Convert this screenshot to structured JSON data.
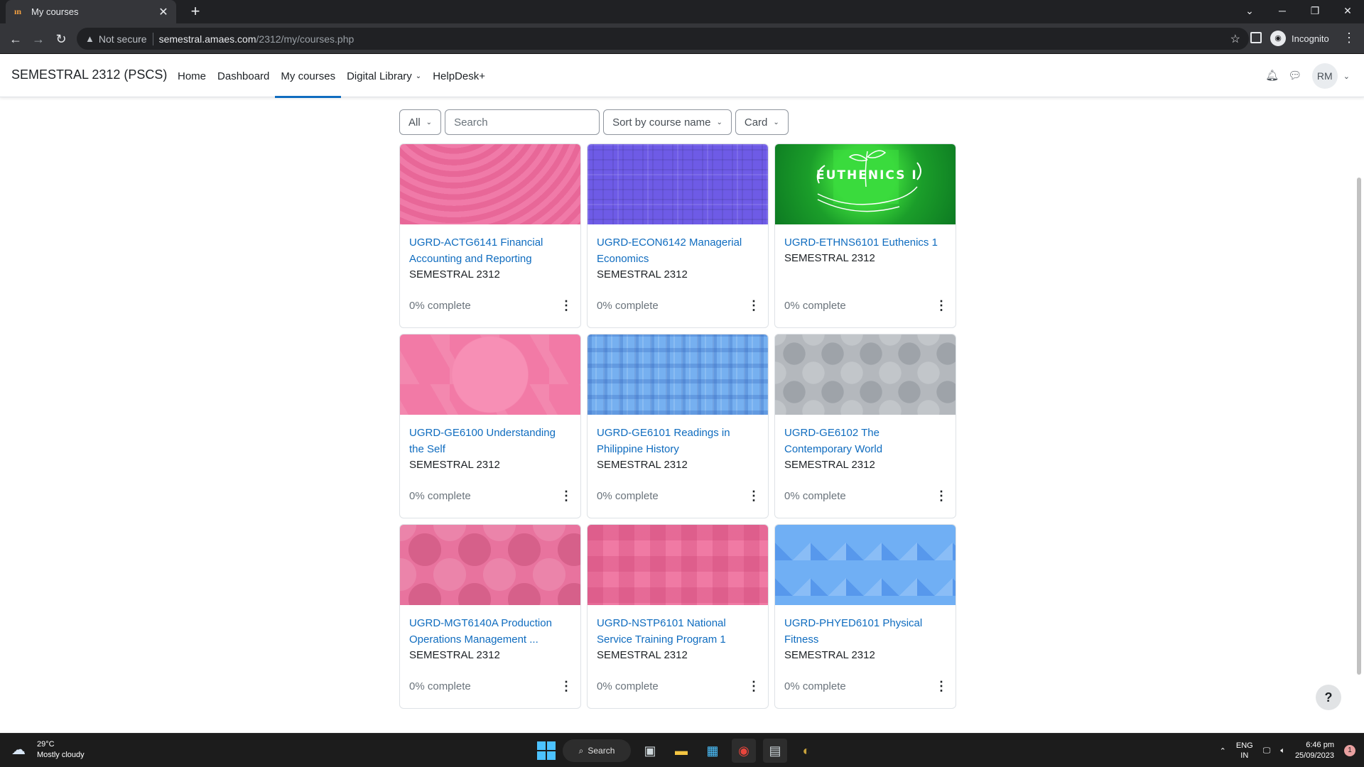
{
  "browser": {
    "tab_title": "My courses",
    "tab_favicon": "ın",
    "security_label": "Not secure",
    "url_host": "semestral.amaes.com",
    "url_path": "/2312/my/courses.php",
    "incognito_label": "Incognito"
  },
  "navbar": {
    "brand": "SEMESTRAL 2312 (PSCS)",
    "links": [
      {
        "label": "Home"
      },
      {
        "label": "Dashboard"
      },
      {
        "label": "My courses"
      },
      {
        "label": "Digital Library"
      },
      {
        "label": "HelpDesk+"
      }
    ],
    "avatar_initials": "RM"
  },
  "filters": {
    "grouping": "All",
    "search_placeholder": "Search",
    "sort": "Sort by course name",
    "view": "Card"
  },
  "courses": [
    {
      "name": "UGRD-ACTG6141 Financial Accounting and Reporting",
      "category": "SEMESTRAL 2312",
      "progress": "0% complete"
    },
    {
      "name": "UGRD-ECON6142 Managerial Economics",
      "category": "SEMESTRAL 2312",
      "progress": "0% complete"
    },
    {
      "name": "UGRD-ETHNS6101 Euthenics 1",
      "category": "SEMESTRAL 2312",
      "progress": "0% complete",
      "image_text": "EUTHENICS I"
    },
    {
      "name": "UGRD-GE6100 Understanding the Self",
      "category": "SEMESTRAL 2312",
      "progress": "0% complete"
    },
    {
      "name": "UGRD-GE6101 Readings in Philippine History",
      "category": "SEMESTRAL 2312",
      "progress": "0% complete"
    },
    {
      "name": "UGRD-GE6102 The Contemporary World",
      "category": "SEMESTRAL 2312",
      "progress": "0% complete"
    },
    {
      "name": "UGRD-MGT6140A Production Operations Management ...",
      "category": "SEMESTRAL 2312",
      "progress": "0% complete"
    },
    {
      "name": "UGRD-NSTP6101 National Service Training Program 1",
      "category": "SEMESTRAL 2312",
      "progress": "0% complete"
    },
    {
      "name": "UGRD-PHYED6101 Physical Fitness",
      "category": "SEMESTRAL 2312",
      "progress": "0% complete"
    }
  ],
  "help_label": "?",
  "taskbar": {
    "temperature": "29°C",
    "weather": "Mostly cloudy",
    "search_label": "Search",
    "lang_top": "ENG",
    "lang_bottom": "IN",
    "time": "6:46 pm",
    "date": "25/09/2023",
    "notification_count": "1"
  }
}
